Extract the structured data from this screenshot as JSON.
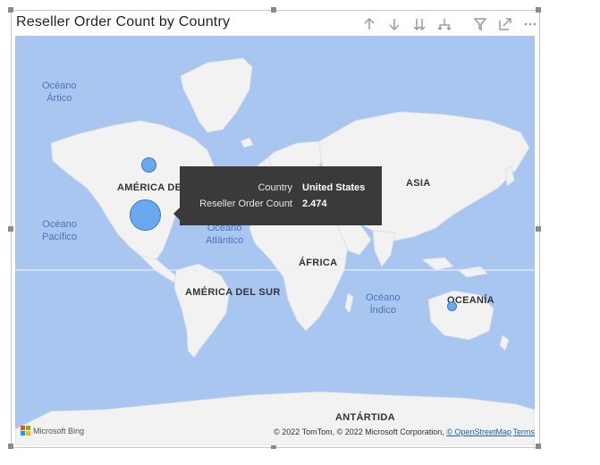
{
  "visual": {
    "title": "Reseller Order Count by Country",
    "header_icons": [
      "arrow-up-icon",
      "arrow-down-icon",
      "double-arrow-down-icon",
      "expand-hierarchy-icon",
      "filter-icon",
      "focus-mode-icon",
      "more-options-icon"
    ]
  },
  "map": {
    "regions": {
      "north_america": "AMÉRICA DEL NORTE",
      "asia": "ASIA",
      "africa": "ÁFRICA",
      "south_america": "AMÉRICA DEL SUR",
      "oceania": "OCEANÍA",
      "antarctica": "ANTÁRTIDA"
    },
    "oceans": {
      "arctic": [
        "Océano",
        "Ártico"
      ],
      "pacific": [
        "Océano",
        "Pacífico"
      ],
      "atlantic": [
        "Océano",
        "Atlántico"
      ],
      "indian": [
        "Océano",
        "Índico"
      ]
    },
    "bubble_color": "#6aa9ee",
    "land_color": "#f2f2f2",
    "water_color": "#a9c6f1"
  },
  "tooltip": {
    "country_label": "Country",
    "country_value": "United States",
    "metric_label": "Reseller Order Count",
    "metric_value": "2.474"
  },
  "footer": {
    "brand": "Microsoft Bing",
    "copyright": "© 2022 TomTom, © 2022 Microsoft Corporation,",
    "osm_link": "© OpenStreetMap",
    "terms": "Terms"
  }
}
